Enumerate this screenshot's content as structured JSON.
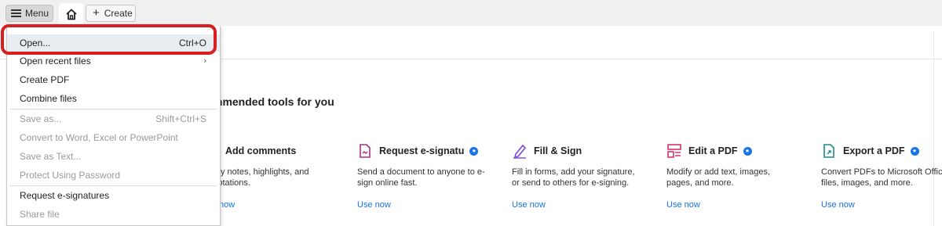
{
  "topbar": {
    "menu_label": "Menu",
    "create_label": "Create"
  },
  "main": {
    "section_title": "Recommended tools for you",
    "section_title_visible": "mmended tools for you",
    "tools": [
      {
        "name": "Add comments",
        "desc": "sticky notes, highlights, and annotations.",
        "link": "now"
      },
      {
        "name": "Request e-signatu",
        "desc": "Send a document to anyone to e-sign online fast.",
        "link": "Use now"
      },
      {
        "name": "Fill & Sign",
        "desc": "Fill in forms, add your signature, or send to others for e-signing.",
        "link": "Use now"
      },
      {
        "name": "Edit a PDF",
        "desc": "Modify or add text, images, pages, and more.",
        "link": "Use now"
      },
      {
        "name": "Export a PDF",
        "desc": "Convert PDFs to Microsoft Office files, images, and more.",
        "link": "Use now"
      }
    ]
  },
  "menu": {
    "items": [
      {
        "label": "Open...",
        "shortcut": "Ctrl+O",
        "enabled": true
      },
      {
        "label": "Open recent files",
        "shortcut": "",
        "enabled": true
      },
      {
        "label": "Create PDF",
        "shortcut": "",
        "enabled": true
      },
      {
        "label": "Combine files",
        "shortcut": "",
        "enabled": true
      },
      {
        "label": "Save as...",
        "shortcut": "Shift+Ctrl+S",
        "enabled": false
      },
      {
        "label": "Convert to Word, Excel or PowerPoint",
        "shortcut": "",
        "enabled": false
      },
      {
        "label": "Save as Text...",
        "shortcut": "",
        "enabled": false
      },
      {
        "label": "Protect Using Password",
        "shortcut": "",
        "enabled": false
      },
      {
        "label": "Request e-signatures",
        "shortcut": "",
        "enabled": true
      },
      {
        "label": "Share file",
        "shortcut": "",
        "enabled": false
      }
    ]
  },
  "colors": {
    "accent": "#1473e6",
    "highlight": "#d81e1e",
    "topbar_bg": "#f0f0f0"
  }
}
